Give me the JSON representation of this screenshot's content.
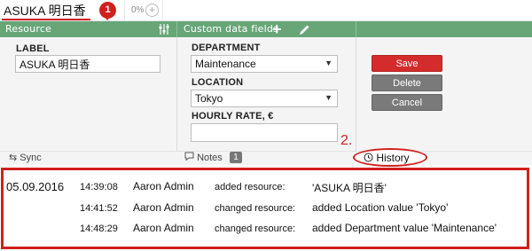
{
  "topbar": {
    "resource_name": "ASUKA 明日香",
    "badge_count": "1",
    "percent": "0%",
    "step1": "1.",
    "step2": "2."
  },
  "resource_panel": {
    "title": "Resource",
    "label_caption": "LABEL",
    "label_value": "ASUKA 明日香"
  },
  "custom_fields": {
    "title": "Custom data fields",
    "department_caption": "DEPARTMENT",
    "department_value": "Maintenance",
    "location_caption": "LOCATION",
    "location_value": "Tokyo",
    "rate_caption": "HOURLY RATE, €",
    "rate_value": ""
  },
  "actions": {
    "save": "Save",
    "delete": "Delete",
    "cancel": "Cancel"
  },
  "tabs": {
    "sync": "Sync",
    "notes": "Notes",
    "notes_count": "1",
    "history": "History"
  },
  "history": {
    "date": "05.09.2016",
    "entries": [
      {
        "time": "14:39:08",
        "user": "Aaron Admin",
        "action": "added resource:",
        "detail": "'ASUKA 明日香'"
      },
      {
        "time": "14:41:52",
        "user": "Aaron Admin",
        "action": "changed resource:",
        "detail": "added Location value 'Tokyo'"
      },
      {
        "time": "14:48:29",
        "user": "Aaron Admin",
        "action": "changed resource:",
        "detail": "added Department value 'Maintenance'"
      }
    ]
  },
  "colors": {
    "accent_green": "#68a678",
    "highlight_red": "#d0201e",
    "save_red": "#d42c2c",
    "button_gray": "#7a7a7a"
  }
}
